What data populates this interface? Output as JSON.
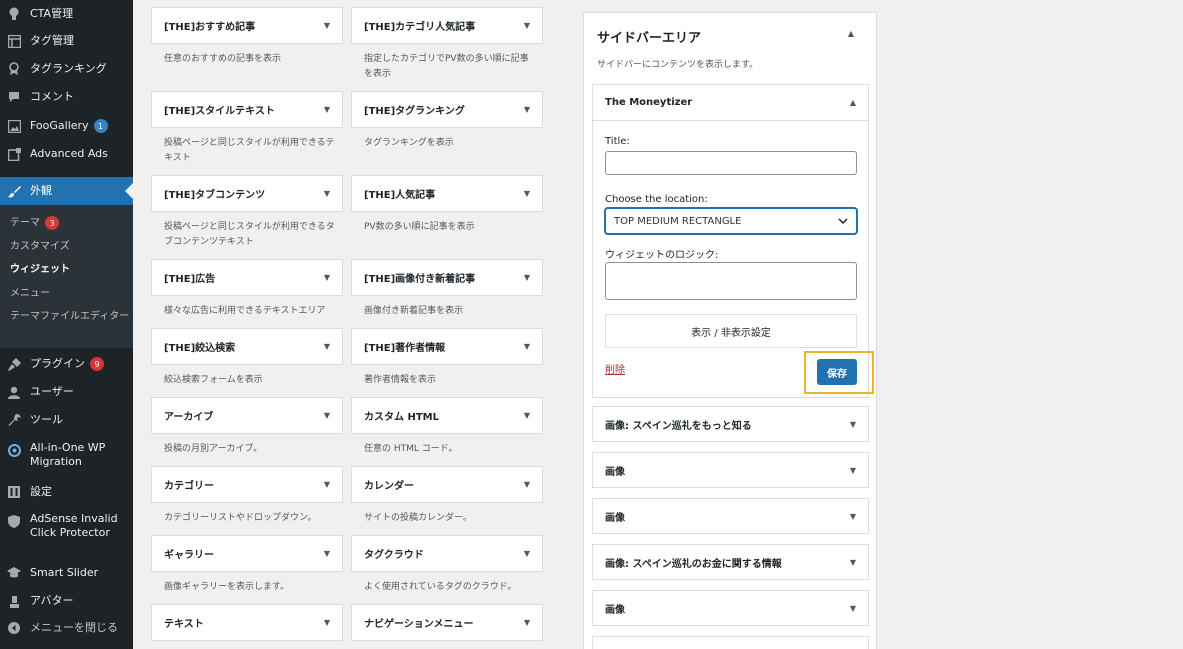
{
  "admin_menu": {
    "items": [
      {
        "label": "CTA管理",
        "icon": "lightbulb-icon"
      },
      {
        "label": "タグ管理",
        "icon": "layout-icon"
      },
      {
        "label": "タグランキング",
        "icon": "award-icon"
      },
      {
        "label": "コメント",
        "icon": "comment-icon"
      },
      {
        "label": "FooGallery",
        "icon": "gallery-icon",
        "badge": "1"
      },
      {
        "label": "Advanced Ads",
        "icon": "ads-icon"
      },
      {
        "label": "外観",
        "icon": "paintbrush-icon"
      },
      {
        "label": "プラグイン",
        "icon": "plugin-icon",
        "badge": "9"
      },
      {
        "label": "ユーザー",
        "icon": "user-icon"
      },
      {
        "label": "ツール",
        "icon": "wrench-icon"
      },
      {
        "label": "All-in-One WP Migration",
        "icon": "migration-icon"
      },
      {
        "label": "設定",
        "icon": "settings-icon"
      },
      {
        "label": "AdSense Invalid Click Protector",
        "icon": "shield-icon"
      },
      {
        "label": "Smart Slider",
        "icon": "slider-icon"
      },
      {
        "label": "アバター",
        "icon": "avatar-icon"
      },
      {
        "label": "メニューを閉じる",
        "icon": "collapse-icon"
      }
    ],
    "submenu": [
      {
        "label": "テーマ",
        "badge": "3"
      },
      {
        "label": "カスタマイズ"
      },
      {
        "label": "ウィジェット"
      },
      {
        "label": "メニュー"
      },
      {
        "label": "テーマファイルエディター"
      }
    ]
  },
  "available_widgets": [
    {
      "title": "[THE]おすすめ記事",
      "desc": "任意のおすすめの記事を表示"
    },
    {
      "title": "[THE]カテゴリ人気記事",
      "desc": "指定したカテゴリでPV数の多い順に記事を表示"
    },
    {
      "title": "[THE]スタイルテキスト",
      "desc": "投稿ページと同じスタイルが利用できるテキスト"
    },
    {
      "title": "[THE]タグランキング",
      "desc": "タグランキングを表示"
    },
    {
      "title": "[THE]タブコンテンツ",
      "desc": "投稿ページと同じスタイルが利用できるタブコンテンツテキスト"
    },
    {
      "title": "[THE]人気記事",
      "desc": "PV数の多い順に記事を表示"
    },
    {
      "title": "[THE]広告",
      "desc": "様々な広告に利用できるテキストエリア"
    },
    {
      "title": "[THE]画像付き新着記事",
      "desc": "画像付き新着記事を表示"
    },
    {
      "title": "[THE]絞込検索",
      "desc": "絞込検索フォームを表示"
    },
    {
      "title": "[THE]著作者情報",
      "desc": "著作者情報を表示"
    },
    {
      "title": "アーカイブ",
      "desc": "投稿の月別アーカイブ。"
    },
    {
      "title": "カスタム HTML",
      "desc": "任意の HTML コード。"
    },
    {
      "title": "カテゴリー",
      "desc": "カテゴリーリストやドロップダウン。"
    },
    {
      "title": "カレンダー",
      "desc": "サイトの投稿カレンダー。"
    },
    {
      "title": "ギャラリー",
      "desc": "画像ギャラリーを表示します。"
    },
    {
      "title": "タグクラウド",
      "desc": "よく使用されているタグのクラウド。"
    },
    {
      "title": "テキスト",
      "desc": ""
    },
    {
      "title": "ナビゲーションメニュー",
      "desc": ""
    }
  ],
  "sidebar_area": {
    "title": "サイドバーエリア",
    "desc": "サイドバーにコンテンツを表示します。",
    "open_widget": {
      "title": "The Moneytizer",
      "title_label": "Title:",
      "title_value": "",
      "location_label": "Choose the location:",
      "location_value": "TOP MEDIUM RECTANGLE",
      "logic_label": "ウィジェットのロジック:",
      "visibility_button": "表示 / 非表示設定",
      "delete_label": "削除",
      "save_label": "保存"
    },
    "widgets": [
      "画像: スペイン巡礼をもっと知る",
      "画像",
      "画像",
      "画像: スペイン巡礼のお金に関する情報",
      "画像",
      ""
    ]
  },
  "colors": {
    "accent": "#2271b1",
    "highlight": "#f0b429",
    "menu_bg": "#1d2327",
    "badge_red": "#d63638"
  }
}
